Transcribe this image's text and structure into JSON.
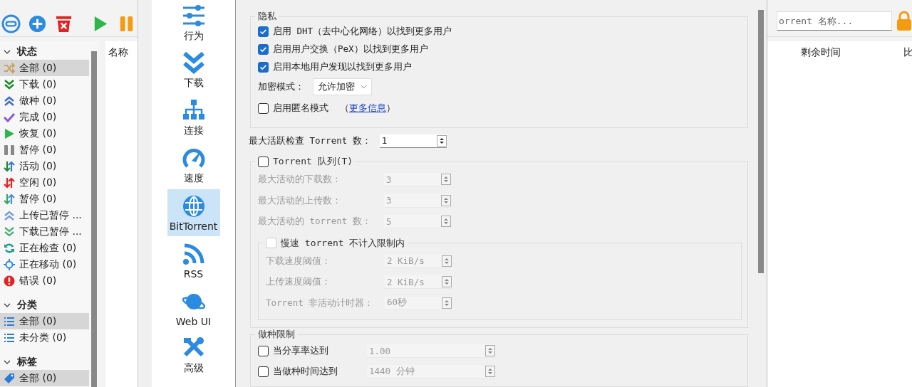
{
  "toolbar": {
    "buttons": [
      {
        "kind": "link"
      },
      {
        "kind": "add"
      },
      {
        "kind": "delete"
      },
      {
        "kind": "resume"
      },
      {
        "kind": "pause"
      }
    ]
  },
  "sidebar": {
    "sections": [
      {
        "title": "状态",
        "expanded": true,
        "items": [
          {
            "label": "全部 (0)",
            "kind": "all",
            "selected": true
          },
          {
            "label": "下载 (0)",
            "kind": "downloading",
            "selected": false
          },
          {
            "label": "做种 (0)",
            "kind": "seeding",
            "selected": false
          },
          {
            "label": "完成 (0)",
            "kind": "completed",
            "selected": false
          },
          {
            "label": "恢复 (0)",
            "kind": "resumed",
            "selected": false
          },
          {
            "label": "暂停 (0)",
            "kind": "paused",
            "selected": false
          },
          {
            "label": "活动 (0)",
            "kind": "active",
            "selected": false
          },
          {
            "label": "空闲 (0)",
            "kind": "inactive",
            "selected": false
          },
          {
            "label": "暂停 (0)",
            "kind": "stalled",
            "selected": false
          },
          {
            "label": "上传已暂停 ...",
            "kind": "upload-paused",
            "selected": false
          },
          {
            "label": "下载已暂停 ...",
            "kind": "download-paused",
            "selected": false
          },
          {
            "label": "正在检查 (0)",
            "kind": "checking",
            "selected": false
          },
          {
            "label": "正在移动 (0)",
            "kind": "moving",
            "selected": false
          },
          {
            "label": "错误 (0)",
            "kind": "error",
            "selected": false
          }
        ]
      },
      {
        "title": "分类",
        "expanded": true,
        "items": [
          {
            "label": "全部 (0)",
            "kind": "category",
            "selected": true
          },
          {
            "label": "未分类 (0)",
            "kind": "category",
            "selected": false
          }
        ]
      },
      {
        "title": "标签",
        "expanded": true,
        "items": [
          {
            "label": "全部 (0)",
            "kind": "tag",
            "selected": true
          }
        ]
      }
    ]
  },
  "torrent_list": {
    "search": {
      "placeholder": "orrent 名称..."
    },
    "columns": [
      "名称",
      "剩余时间",
      "比"
    ]
  },
  "options": {
    "pages": [
      {
        "label": "行为",
        "kind": "behavior",
        "selected": false
      },
      {
        "label": "下载",
        "kind": "downloads",
        "selected": false
      },
      {
        "label": "连接",
        "kind": "connection",
        "selected": false
      },
      {
        "label": "速度",
        "kind": "speed",
        "selected": false
      },
      {
        "label": "BitTorrent",
        "kind": "bittorrent",
        "selected": true
      },
      {
        "label": "RSS",
        "kind": "rss",
        "selected": false
      },
      {
        "label": "Web UI",
        "kind": "webui",
        "selected": false
      },
      {
        "label": "高级",
        "kind": "advanced",
        "selected": false
      }
    ],
    "privacy": {
      "title": "隐私",
      "options": [
        {
          "label": "启用 DHT（去中心化网络）以找到更多用户",
          "checked": true
        },
        {
          "label": "启用用户交换（PeX）以找到更多用户",
          "checked": true
        },
        {
          "label": "启用本地用户发现以找到更多用户",
          "checked": true
        }
      ],
      "encryption": {
        "label": "加密模式：",
        "value": "允许加密"
      },
      "anonymous": {
        "label": "启用匿名模式",
        "checked": false,
        "before": "（",
        "link": "更多信息",
        "after": "）"
      }
    },
    "max_checking": {
      "label": "最大活跃检查 Torrent 数：",
      "value": "1"
    },
    "queue": {
      "label": "Torrent 队列(T)",
      "checked": false,
      "rows": [
        {
          "label": "最大活动的下载数：",
          "value": "3"
        },
        {
          "label": "最大活动的上传数：",
          "value": "3"
        },
        {
          "label": "最大活动的 torrent 数：",
          "value": "5"
        }
      ],
      "slow": {
        "label": "慢速 torrent 不计入限制内",
        "checked": false,
        "rows": [
          {
            "label": "下载速度阈值：",
            "value": "2 KiB/s"
          },
          {
            "label": "上传速度阈值：",
            "value": "2 KiB/s"
          },
          {
            "label": "Torrent 非活动计时器：",
            "value": "60秒"
          }
        ]
      }
    },
    "seeding": {
      "title": "做种限制",
      "rows": [
        {
          "label": "当分享率达到",
          "checked": false,
          "value": "1.00"
        },
        {
          "label": "当做种时间达到",
          "checked": false,
          "value": "1440 分钟"
        }
      ]
    }
  }
}
